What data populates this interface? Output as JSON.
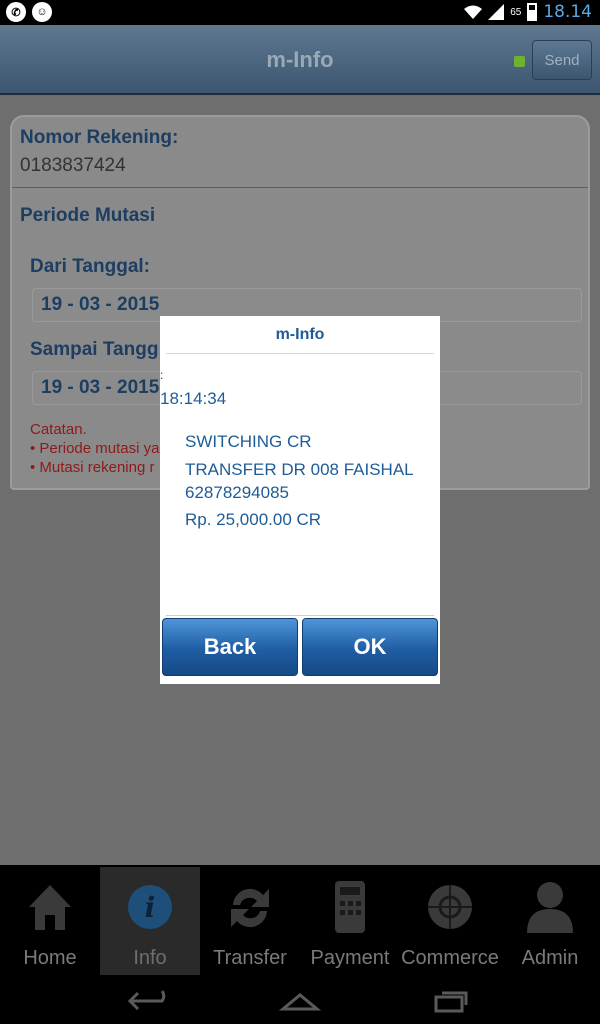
{
  "status_bar": {
    "left_icons": [
      "whatsapp-icon",
      "chat-icon"
    ],
    "battery": "65",
    "time": "18.14"
  },
  "header": {
    "title": "m-Info",
    "send_label": "Send",
    "indicator_color": "#6fb230"
  },
  "form": {
    "account_label": "Nomor Rekening:",
    "account_number": "0183837424",
    "period_label": "Periode Mutasi",
    "from_label": "Dari Tanggal:",
    "from_date": "19 - 03 - 2015",
    "to_label": "Sampai Tangg",
    "to_date": "19 - 03 - 2015",
    "note_title": "Catatan.",
    "notes": [
      "• Periode mutasi ya",
      "• Mutasi rekening r"
    ]
  },
  "dialog": {
    "title": "m-Info",
    "colon": ":",
    "time": "18:14:34",
    "lines": [
      "SWITCHING CR",
      "TRANSFER DR 008 FAISHAL",
      "62878294085",
      "Rp. 25,000.00 CR"
    ],
    "back_label": "Back",
    "ok_label": "OK"
  },
  "tabs": [
    {
      "label": "Home",
      "icon": "home-icon",
      "active": false
    },
    {
      "label": "Info",
      "icon": "info-icon",
      "active": true
    },
    {
      "label": "Transfer",
      "icon": "transfer-icon",
      "active": false
    },
    {
      "label": "Payment",
      "icon": "payment-icon",
      "active": false
    },
    {
      "label": "Commerce",
      "icon": "commerce-icon",
      "active": false
    },
    {
      "label": "Admin",
      "icon": "admin-icon",
      "active": false
    }
  ],
  "nav_bar": [
    "back-icon",
    "home-icon",
    "recents-icon"
  ],
  "colors": {
    "accent_blue": "#1e5c97",
    "status_time": "#5aa9e6",
    "note_red": "#8e1a1a"
  }
}
